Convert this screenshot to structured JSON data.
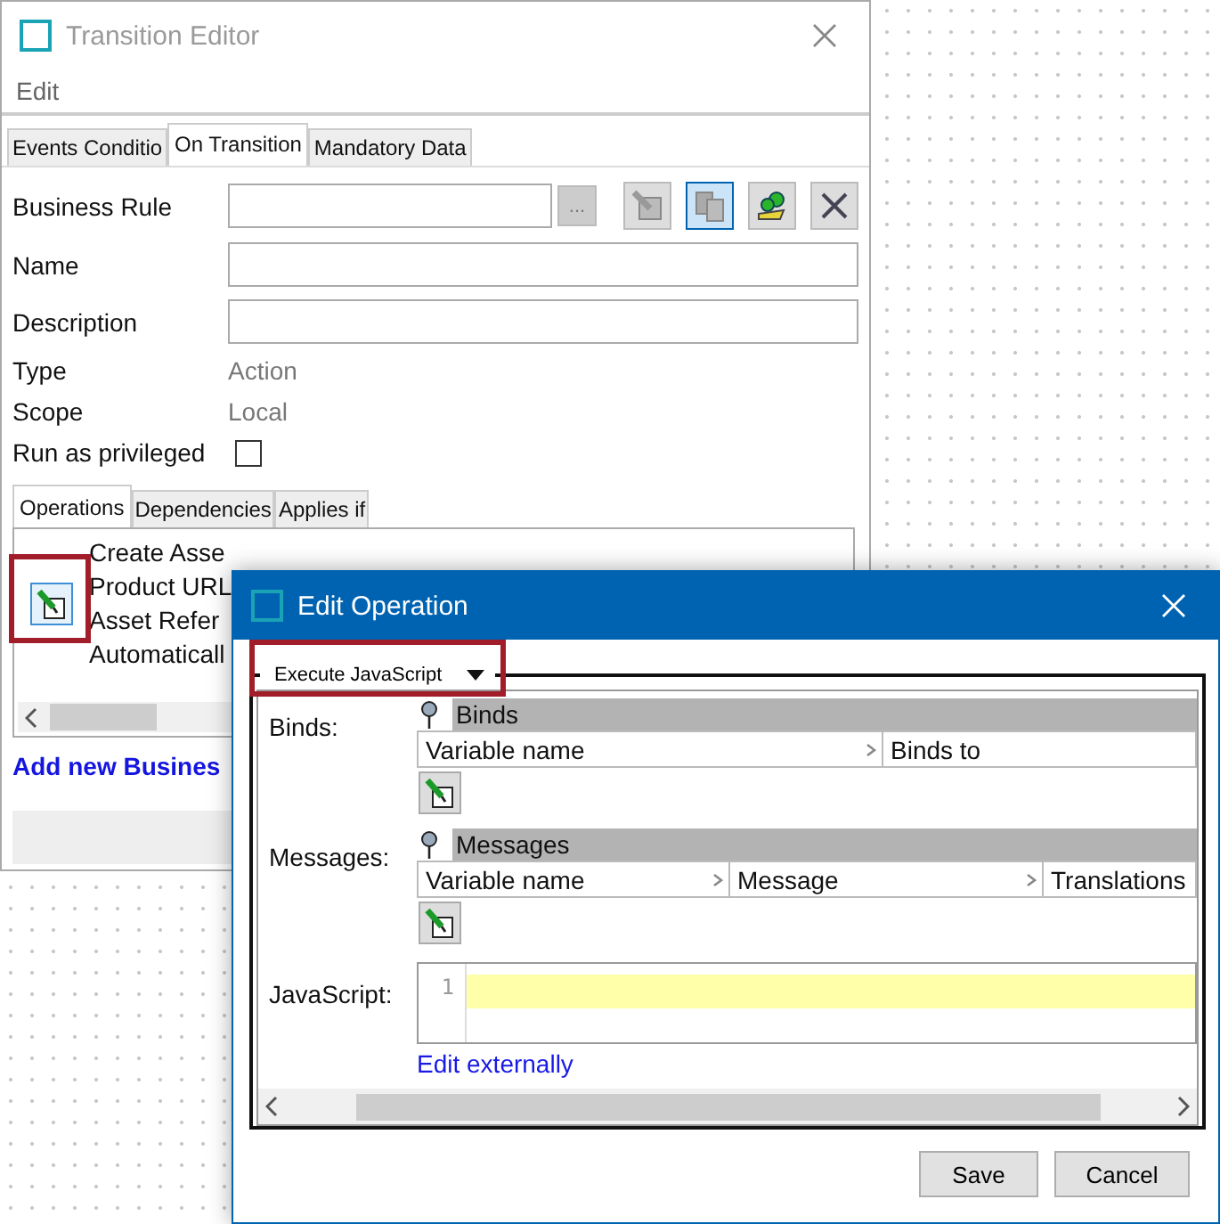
{
  "transition_editor": {
    "title": "Transition Editor",
    "menu": [
      "Edit"
    ],
    "tabs": [
      {
        "label": "Events Conditio",
        "selected": false
      },
      {
        "label": "On Transition",
        "selected": true
      },
      {
        "label": "Mandatory Data",
        "selected": false
      }
    ],
    "business_rule": {
      "label": "Business Rule",
      "browse": "...",
      "tools": [
        {
          "kind": "edit",
          "selected": false
        },
        {
          "kind": "copy",
          "selected": true
        },
        {
          "kind": "gears",
          "selected": false
        },
        {
          "kind": "delete",
          "selected": false
        }
      ]
    },
    "fields": [
      {
        "kind": "input",
        "label": "Name"
      },
      {
        "kind": "input",
        "label": "Description"
      },
      {
        "kind": "value",
        "label": "Type",
        "value": "Action"
      },
      {
        "kind": "value",
        "label": "Scope",
        "value": "Local"
      },
      {
        "kind": "checkbox",
        "label": "Run as privileged",
        "checked": false
      }
    ],
    "subtabs": [
      {
        "label": "Operations",
        "selected": true
      },
      {
        "label": "Dependencies",
        "selected": false
      },
      {
        "label": "Applies if",
        "selected": false
      }
    ],
    "operation": {
      "highlighted": true,
      "lines": [
        "Create Asse",
        "Product URL",
        "Asset Refer",
        "Automaticall"
      ]
    },
    "link": "Add new Busines"
  },
  "edit_operation": {
    "title": "Edit Operation",
    "operation_type": {
      "value": "Execute JavaScript",
      "highlighted": true
    },
    "tables": [
      {
        "label": "Binds:",
        "header": "Binds",
        "columns": [
          "Variable name",
          "Binds to"
        ]
      },
      {
        "label": "Messages:",
        "header": "Messages",
        "columns": [
          "Variable name",
          "Message",
          "Translations"
        ]
      }
    ],
    "javascript": {
      "label": "JavaScript:",
      "line_numbers": [
        "1"
      ],
      "link": "Edit externally"
    },
    "buttons": [
      "Save",
      "Cancel"
    ]
  }
}
